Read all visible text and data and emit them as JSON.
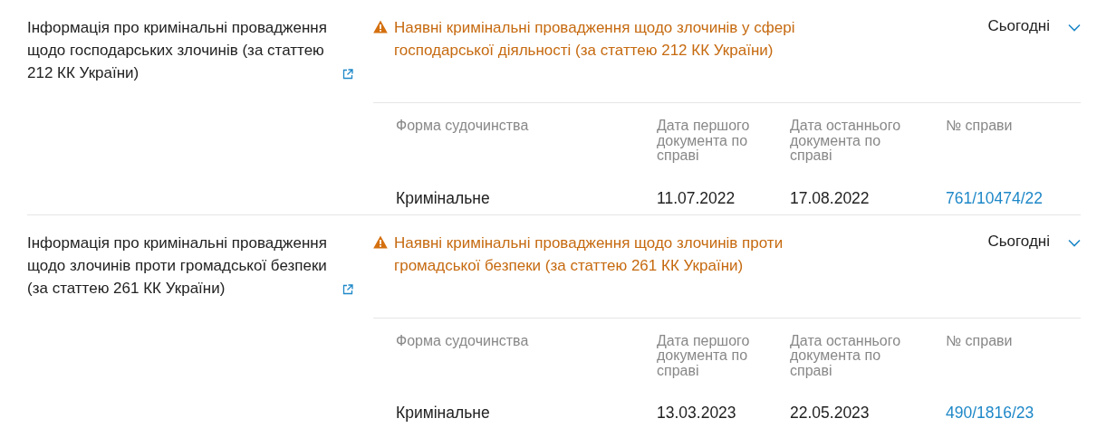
{
  "sections": [
    {
      "title": "Інформація про кримінальні провадження щодо господарських злочинів (за статтею 212 КК України)",
      "status": {
        "kind": "warning",
        "text": "Наявні кримінальні провадження щодо злочинів у сфері господарської діяльності (за статтею 212 КК України)"
      },
      "updated": "Сьогодні",
      "expanded": true,
      "table": {
        "columns": [
          {
            "label": "Форма судочинства",
            "kind": "text"
          },
          {
            "label": "Дата першого документа по справі",
            "kind": "text"
          },
          {
            "label": "Дата останнього документа по справі",
            "kind": "text"
          },
          {
            "label": "№ справи",
            "kind": "link"
          }
        ],
        "rows": [
          [
            "Кримінальне",
            "11.07.2022",
            "17.08.2022",
            "761/10474/22"
          ]
        ]
      }
    },
    {
      "title": "Інформація про кримінальні провадження щодо злочинів проти громадської безпеки (за статтею 261 КК України)",
      "status": {
        "kind": "warning",
        "text": "Наявні кримінальні провадження щодо злочинів проти громадської безпеки (за статтею 261 КК України)"
      },
      "updated": "Сьогодні",
      "expanded": true,
      "table": {
        "columns": [
          {
            "label": "Форма судочинства",
            "kind": "text"
          },
          {
            "label": "Дата першого документа по справі",
            "kind": "text"
          },
          {
            "label": "Дата останнього документа по справі",
            "kind": "text"
          },
          {
            "label": "№ справи",
            "kind": "link"
          }
        ],
        "rows": [
          [
            "Кримінальне",
            "13.03.2023",
            "22.05.2023",
            "490/1816/23"
          ]
        ]
      }
    }
  ]
}
